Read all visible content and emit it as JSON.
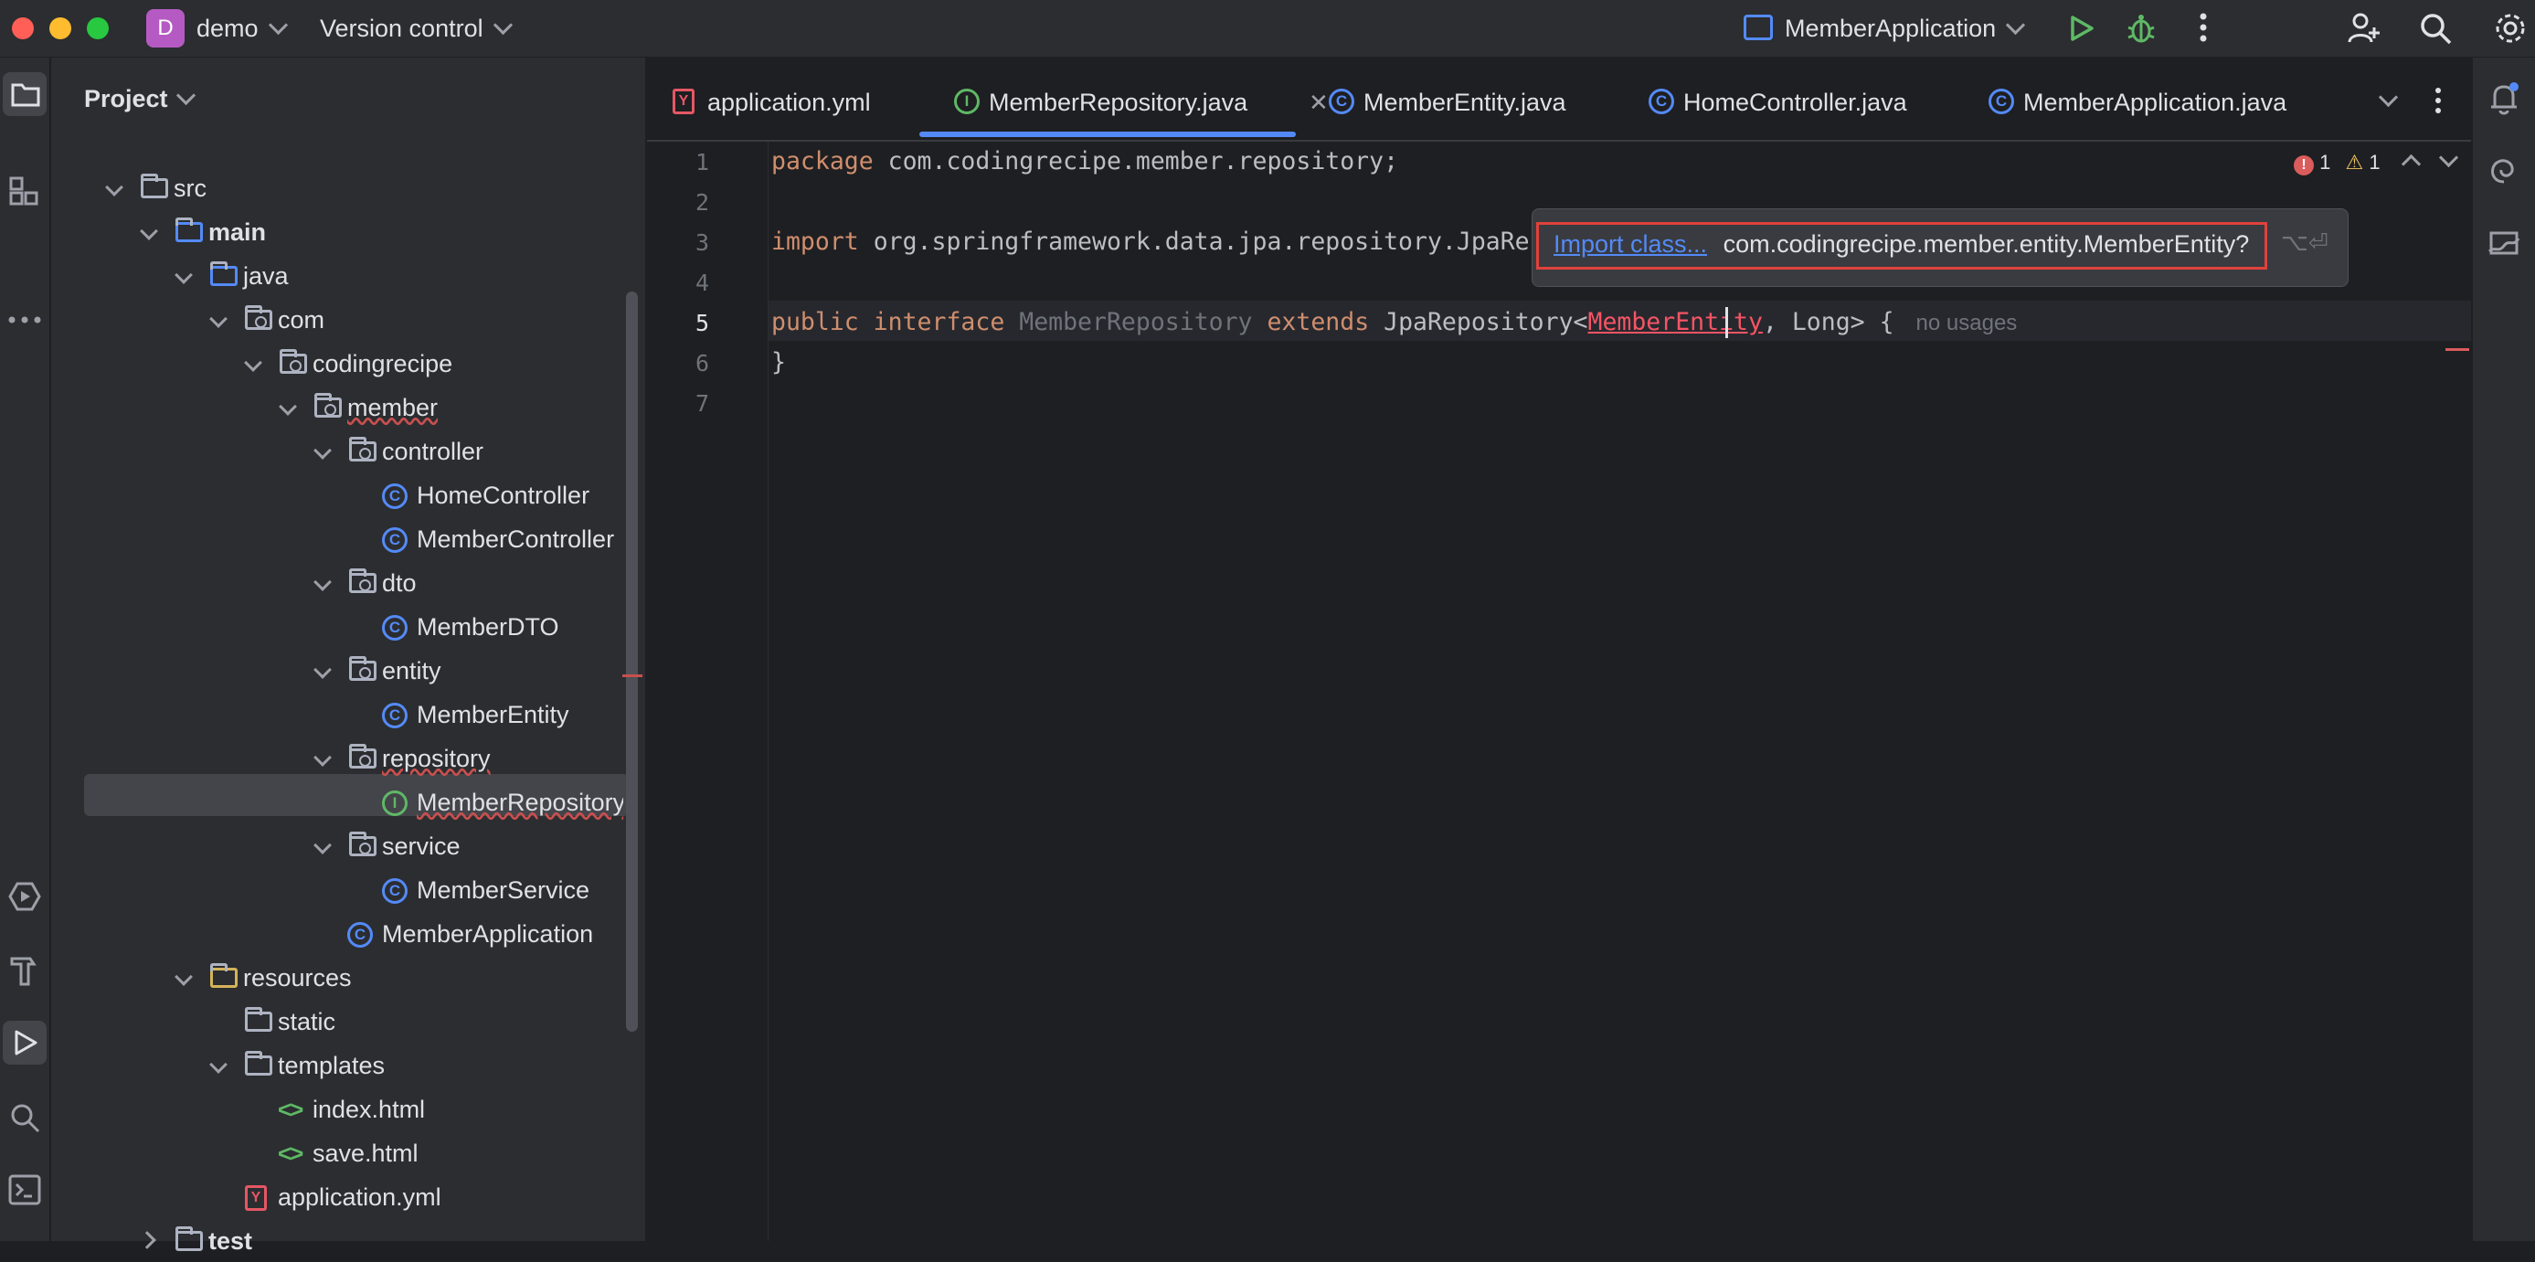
{
  "titlebar": {
    "project_badge": "D",
    "project_name": "demo",
    "vcs_label": "Version control",
    "run_config": "MemberApplication"
  },
  "project_panel": {
    "title": "Project",
    "tree": [
      {
        "label": "src",
        "type": "folder"
      },
      {
        "label": "main",
        "type": "folder"
      },
      {
        "label": "java",
        "type": "folder"
      },
      {
        "label": "com",
        "type": "package"
      },
      {
        "label": "codingrecipe",
        "type": "package"
      },
      {
        "label": "member",
        "type": "package"
      },
      {
        "label": "controller",
        "type": "package"
      },
      {
        "label": "HomeController",
        "type": "class"
      },
      {
        "label": "MemberController",
        "type": "class"
      },
      {
        "label": "dto",
        "type": "package"
      },
      {
        "label": "MemberDTO",
        "type": "class"
      },
      {
        "label": "entity",
        "type": "package"
      },
      {
        "label": "MemberEntity",
        "type": "class"
      },
      {
        "label": "repository",
        "type": "package"
      },
      {
        "label": "MemberRepository",
        "type": "interface"
      },
      {
        "label": "service",
        "type": "package"
      },
      {
        "label": "MemberService",
        "type": "class"
      },
      {
        "label": "MemberApplication",
        "type": "class"
      },
      {
        "label": "resources",
        "type": "folder"
      },
      {
        "label": "static",
        "type": "folder"
      },
      {
        "label": "templates",
        "type": "folder"
      },
      {
        "label": "index.html",
        "type": "html"
      },
      {
        "label": "save.html",
        "type": "html"
      },
      {
        "label": "application.yml",
        "type": "yml"
      },
      {
        "label": "test",
        "type": "folder"
      }
    ]
  },
  "tabs": [
    {
      "label": "application.yml",
      "icon": "yml-icon"
    },
    {
      "label": "MemberRepository.java",
      "icon": "interface-icon",
      "active": true
    },
    {
      "label": "MemberEntity.java",
      "icon": "class-icon"
    },
    {
      "label": "HomeController.java",
      "icon": "class-icon"
    },
    {
      "label": "MemberApplication.java",
      "icon": "spring-class-icon"
    }
  ],
  "inspections": {
    "errors": "1",
    "warnings": "1"
  },
  "code": {
    "line_numbers": [
      "1",
      "2",
      "3",
      "4",
      "5",
      "6",
      "7"
    ],
    "l1_kw": "package",
    "l1_rest": " com.codingrecipe.member.repository;",
    "l3_kw": "import",
    "l3_rest": " org.springframework.data.jpa.repository.JpaRepo",
    "l5_kw1": "public interface",
    "l5_name": " MemberRepository ",
    "l5_kw2": "extends",
    "l5_mid": " JpaRepository<",
    "l5_err": "MemberEntity",
    "l5_end": ", Long> {",
    "l5_hint": "no usages",
    "l6": "}"
  },
  "popup": {
    "link": "Import class...",
    "text": "com.codingrecipe.member.entity.MemberEntity?",
    "shortcut": "⌥⏎"
  },
  "colors": {
    "accent": "#548af7",
    "error": "#f75464",
    "warning": "#f2c55c",
    "run_green": "#5fb865",
    "highlight_box": "#e0413b"
  }
}
